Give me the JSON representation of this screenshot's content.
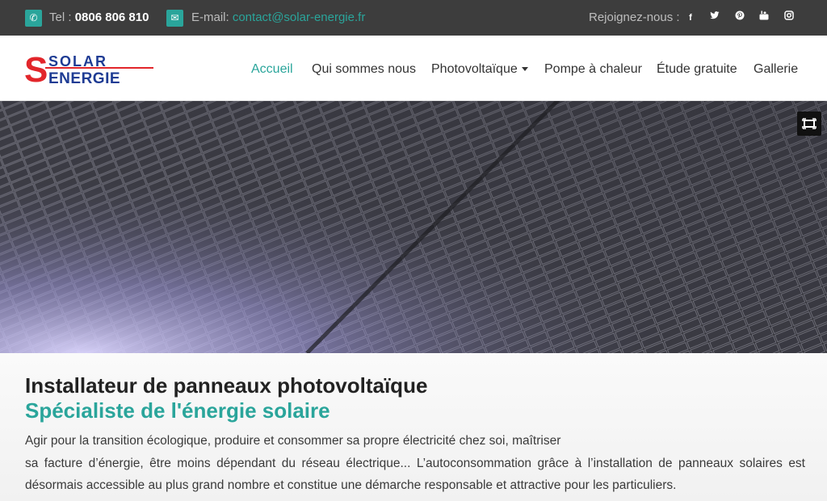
{
  "topbar": {
    "phone_label": "Tel : ",
    "phone_number": "0806 806 810",
    "email_label": "E-mail: ",
    "email_value": "contact@solar-energie.fr",
    "join_label": "Rejoignez-nous :",
    "social_icons": [
      "facebook-icon",
      "twitter-icon",
      "pinterest-icon",
      "youtube-icon",
      "instagram-icon"
    ]
  },
  "logo": {
    "line1": "SOLAR",
    "line2": "ENERGIE",
    "letter": "S"
  },
  "nav": {
    "items": [
      {
        "label": "Accueil",
        "active": true
      },
      {
        "label": "Qui sommes nous"
      },
      {
        "label": "Photovoltaïque",
        "dropdown": true
      },
      {
        "label": "Pompe à chaleur"
      },
      {
        "label": "Étude gratuite"
      },
      {
        "label": "Gallerie"
      }
    ]
  },
  "main": {
    "title": "Installateur de panneaux photovoltaïque",
    "subtitle": "Spécialiste de l'énergie solaire",
    "paragraph_lines": [
      "Agir pour la transition écologique, produire et consommer sa propre électricité chez soi, maîtriser",
      "sa facture d’énergie, être moins dépendant du réseau électrique... L’autoconsommation grâce à l’installation de panneaux solaires est",
      "désormais accessible au plus grand nombre et constitue une démarche responsable et attractive pour les particuliers."
    ]
  },
  "colors": {
    "accent": "#2aa59b",
    "topbar": "#3d3d3d",
    "logo_red": "#e2262b",
    "logo_blue": "#1f3c94"
  }
}
